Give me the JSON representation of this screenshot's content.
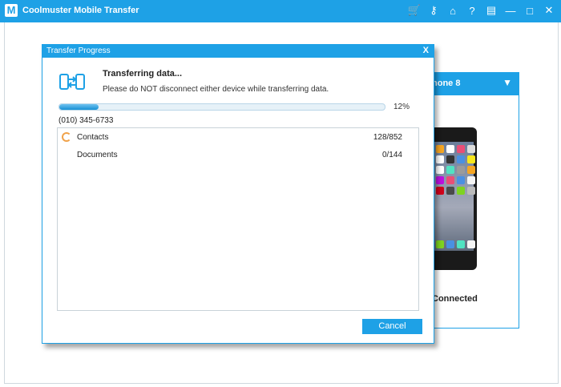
{
  "app": {
    "title": "Coolmuster Mobile Transfer",
    "logo_letter": "M"
  },
  "titlebar_icons": [
    "cart-icon",
    "key-icon",
    "home-icon",
    "help-icon",
    "feedback-icon",
    "minimize-icon",
    "maximize-icon",
    "close-icon"
  ],
  "device": {
    "name": "hone 8",
    "status": "Connected"
  },
  "dialog": {
    "title": "Transfer Progress",
    "close": "X",
    "heading": "Transferring data...",
    "message": "Please do NOT disconnect either device while transferring data.",
    "progress_percent": 12,
    "progress_label": "12%",
    "phone_number": "(010) 345-6733",
    "items": [
      {
        "name": "Contacts",
        "count": "128/852",
        "in_progress": true
      },
      {
        "name": "Documents",
        "count": "0/144",
        "in_progress": false
      }
    ],
    "cancel_label": "Cancel"
  },
  "colors": {
    "accent": "#1ea1e6",
    "spinner": "#f0a24a"
  }
}
